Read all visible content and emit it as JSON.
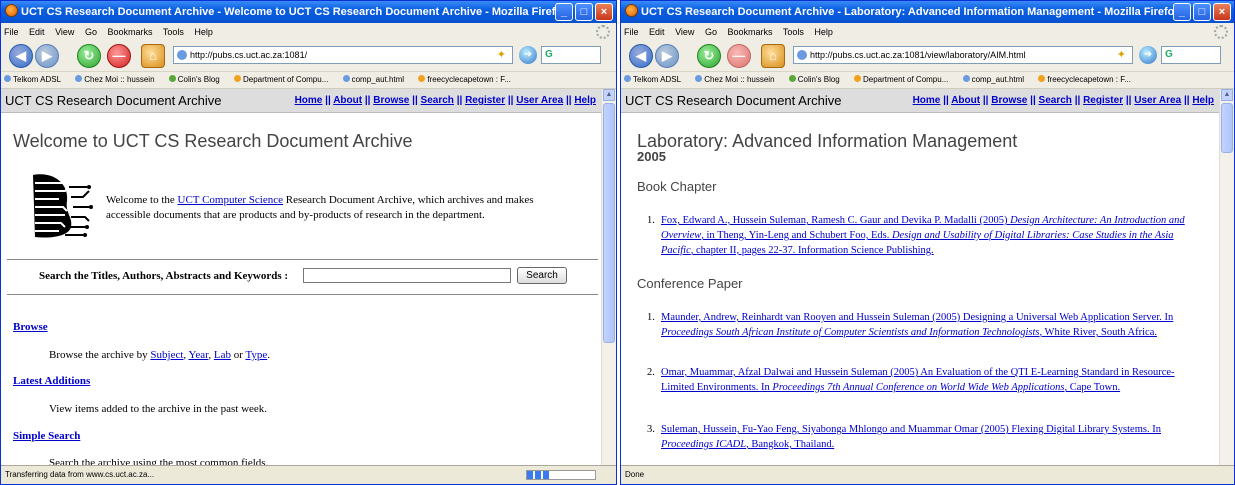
{
  "w1": {
    "title": "UCT CS Research Document Archive - Welcome to UCT CS Research Document Archive - Mozilla Firefox",
    "menu": [
      "File",
      "Edit",
      "View",
      "Go",
      "Bookmarks",
      "Tools",
      "Help"
    ],
    "url": "http://pubs.cs.uct.ac.za:1081/",
    "search_engine": "G",
    "bookmarks": [
      "Telkom ADSL",
      "Chez Moi :: hussein",
      "Colin's Blog",
      "Department of Compu...",
      "comp_aut.html",
      "freecyclecapetown : F..."
    ],
    "site_title": "UCT CS Research Document Archive",
    "nav": [
      "Home",
      "About",
      "Browse",
      "Search",
      "Register",
      "User Area",
      "Help"
    ],
    "heading": "Welcome to UCT CS Research Document Archive",
    "intro_before": "Welcome to the ",
    "intro_link": "UCT Computer Science",
    "intro_after": " Research Document Archive, which archives and makes accessible documents that are products and by-products of research in the department.",
    "search_label": "Search the Titles, Authors, Abstracts and Keywords",
    "search_button": "Search",
    "browse_head": "Browse",
    "browse_pre": "Browse the archive by ",
    "browse_subject": "Subject",
    "browse_year": "Year",
    "browse_lab": "Lab",
    "browse_or": " or ",
    "browse_type": "Type",
    "latest_head": "Latest Additions",
    "latest_text": "View items added to the archive in the past week.",
    "simple_head": "Simple Search",
    "simple_text": "Search the archive using the most common fields.",
    "status": "Transferring data from www.cs.uct.ac.za...",
    "progress": 0.35
  },
  "w2": {
    "title": "UCT CS Research Document Archive - Laboratory: Advanced Information Management - Mozilla Firefox",
    "menu": [
      "File",
      "Edit",
      "View",
      "Go",
      "Bookmarks",
      "Tools",
      "Help"
    ],
    "url": "http://pubs.cs.uct.ac.za:1081/view/laboratory/AIM.html",
    "search_engine": "G",
    "bookmarks": [
      "Telkom ADSL",
      "Chez Moi :: hussein",
      "Colin's Blog",
      "Department of Compu...",
      "comp_aut.html",
      "freecyclecapetown : F..."
    ],
    "site_title": "UCT CS Research Document Archive",
    "nav": [
      "Home",
      "About",
      "Browse",
      "Search",
      "Register",
      "User Area",
      "Help"
    ],
    "heading": "Laboratory: Advanced Information Management",
    "year": "2005",
    "book_chapter": "Book Chapter",
    "conf_paper": "Conference Paper",
    "entries": [
      {
        "num": "1.",
        "a": "Fox, Edward A., Hussein Suleman, Ramesh C. Gaur and Devika P. Madalli (2005) ",
        "i1": "Design Architecture: An Introduction and Overview",
        "b": ", in Theng, Yin-Leng and Schubert Foo, Eds. ",
        "i2": "Design and Usability of Digital Libraries: Case Studies in the Asia Pacific",
        "c": ", chapter II, pages 22-37. Information Science Publishing."
      },
      {
        "num": "1.",
        "a": "Maunder, Andrew, Reinhardt van Rooyen and Hussein Suleman (2005) Designing a Universal Web Application Server. In ",
        "i1": "Proceedings South African Institute of Computer Scientists and Information Technologists",
        "b": ", White River, South Africa.",
        "i2": "",
        "c": ""
      },
      {
        "num": "2.",
        "a": "Omar, Muammar, Afzal Dalwai and Hussein Suleman (2005) An Evaluation of the QTI E-Learning Standard in Resource-Limited Environments. In ",
        "i1": "Proceedings 7th Annual Conference on World Wide Web Applications",
        "b": ", Cape Town.",
        "i2": "",
        "c": ""
      },
      {
        "num": "3.",
        "a": "Suleman, Hussein, Fu-Yao Feng, Siyabonga Mhlongo and Muammar Omar (2005) Flexing Digital Library Systems. In ",
        "i1": "Proceedings ICADL",
        "b": ", Bangkok, Thailand.",
        "i2": "",
        "c": ""
      }
    ],
    "status": "Done"
  }
}
